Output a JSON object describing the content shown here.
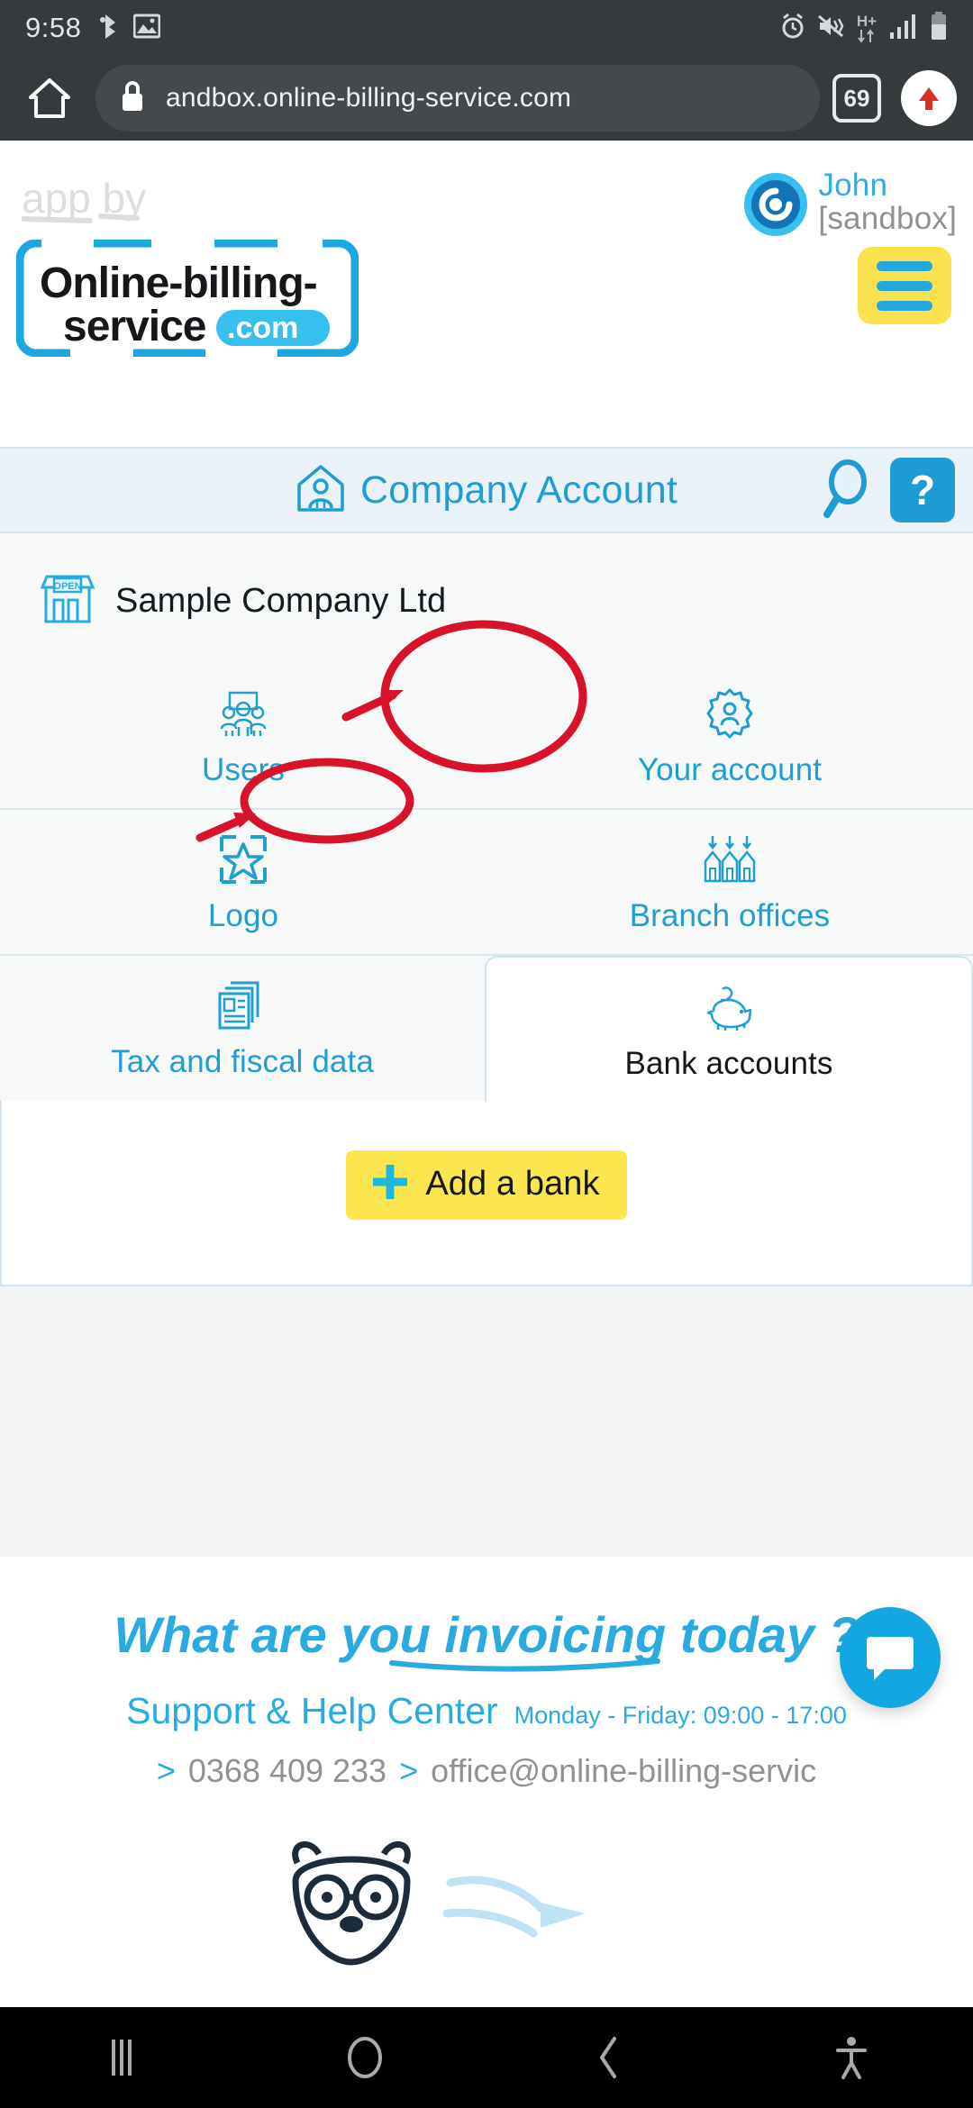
{
  "status_bar": {
    "clock": "9:58",
    "left_icons": [
      "bluetooth-audio-icon",
      "image-icon"
    ],
    "right_icons": [
      "alarm-icon",
      "mute-vibrate-icon",
      "hplus-data-icon",
      "signal-bars-icon",
      "battery-icon"
    ],
    "network_label": "H+"
  },
  "browser": {
    "home_icon": "home-icon",
    "lock_icon": "lock-icon",
    "url": "andbox.online-billing-service.com",
    "tab_count": "69",
    "menu_icon": "upload-arrow-icon"
  },
  "site_header": {
    "app_by": "app by",
    "logo_line1": "Online-billing-",
    "logo_line2": "service",
    "logo_badge": ".com",
    "user_name": "John",
    "user_env": "[sandbox]",
    "avatar_icon": "spiral-avatar-icon",
    "menu_icon": "hamburger-menu-icon"
  },
  "title_bar": {
    "icon": "company-account-icon",
    "title": "Company Account",
    "search_icon": "search-icon",
    "help_label": "?"
  },
  "company": {
    "icon": "shop-open-icon",
    "name": "Sample Company Ltd"
  },
  "tiles": [
    [
      {
        "label": "Users",
        "icon": "users-group-icon",
        "active": false
      },
      {
        "label": "Your account",
        "icon": "gear-user-icon",
        "active": false
      }
    ],
    [
      {
        "label": "Logo",
        "icon": "logo-star-icon",
        "active": false
      },
      {
        "label": "Branch offices",
        "icon": "branch-offices-icon",
        "active": false
      }
    ],
    [
      {
        "label": "Tax and fiscal data",
        "icon": "tax-document-icon",
        "active": false
      },
      {
        "label": "Bank accounts",
        "icon": "piggy-bank-icon",
        "active": true
      }
    ]
  ],
  "panel": {
    "add_bank_label": "Add a bank",
    "add_bank_icon": "plus-icon",
    "highlight_color": "#fbe64f"
  },
  "footer": {
    "headline": "What are you invoicing today ?",
    "support_title": "Support & Help Center",
    "support_hours": "Monday - Friday: 09:00 - 17:00",
    "phone": "0368 409 233",
    "email": "office@online-billing-servic",
    "chevron": ">",
    "chat_icon": "chat-bubble-icon",
    "mascot_icon": "bear-mascot-icon"
  },
  "annotations": {
    "circle_color": "#d81228",
    "arrow_color": "#d81228",
    "items": [
      "bank-accounts-tab-circle",
      "bank-accounts-arrow",
      "add-a-bank-circle",
      "add-a-bank-arrow"
    ]
  },
  "nav_bar": {
    "recents_icon": "recents-icon",
    "home_icon": "home-circle-icon",
    "back_icon": "back-chevron-icon",
    "accessibility_icon": "accessibility-icon"
  },
  "colors": {
    "brand_blue": "#1f9ed4",
    "accent_yellow": "#fbe14d",
    "annotation_red": "#d81228",
    "chrome_dark": "#353a3d"
  }
}
